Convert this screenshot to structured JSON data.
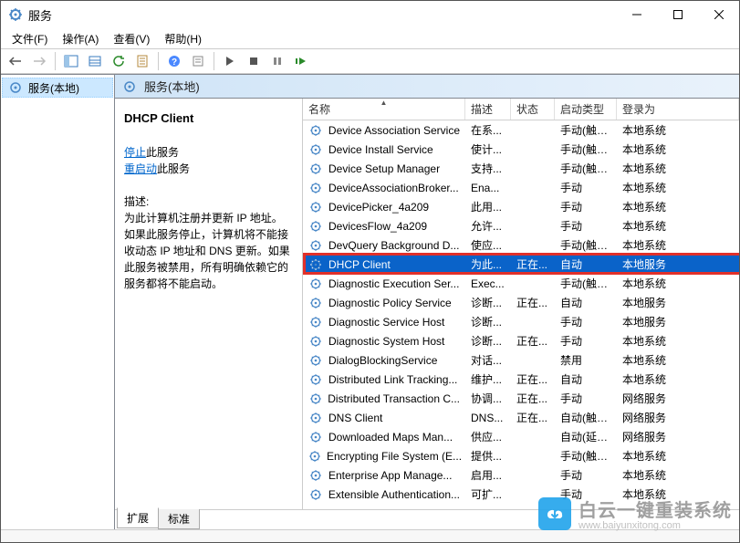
{
  "window": {
    "title": "服务"
  },
  "menubar": {
    "file": "文件(F)",
    "action": "操作(A)",
    "view": "查看(V)",
    "help": "帮助(H)"
  },
  "tree": {
    "root": "服务(本地)"
  },
  "rightHeader": {
    "label": "服务(本地)"
  },
  "detail": {
    "service_name": "DHCP Client",
    "stop_link": "停止",
    "stop_suffix": "此服务",
    "restart_link": "重启动",
    "restart_suffix": "此服务",
    "desc_label": "描述:",
    "desc_text": "为此计算机注册并更新 IP 地址。如果此服务停止，计算机将不能接收动态 IP 地址和 DNS 更新。如果此服务被禁用，所有明确依赖它的服务都将不能启动。"
  },
  "columns": {
    "name": "名称",
    "desc": "描述",
    "status": "状态",
    "start": "启动类型",
    "logon": "登录为"
  },
  "tabs": {
    "extended": "扩展",
    "standard": "标准"
  },
  "watermark": {
    "big": "白云一键重装系统",
    "small": "www.baiyunxitong.com"
  },
  "selected_index": 7,
  "services": [
    {
      "name": "Device Association Service",
      "desc": "在系...",
      "status": "",
      "start": "手动(触发...",
      "logon": "本地系统"
    },
    {
      "name": "Device Install Service",
      "desc": "使计...",
      "status": "",
      "start": "手动(触发...",
      "logon": "本地系统"
    },
    {
      "name": "Device Setup Manager",
      "desc": "支持...",
      "status": "",
      "start": "手动(触发...",
      "logon": "本地系统"
    },
    {
      "name": "DeviceAssociationBroker...",
      "desc": "Ena...",
      "status": "",
      "start": "手动",
      "logon": "本地系统"
    },
    {
      "name": "DevicePicker_4a209",
      "desc": "此用...",
      "status": "",
      "start": "手动",
      "logon": "本地系统"
    },
    {
      "name": "DevicesFlow_4a209",
      "desc": "允许...",
      "status": "",
      "start": "手动",
      "logon": "本地系统"
    },
    {
      "name": "DevQuery Background D...",
      "desc": "使应...",
      "status": "",
      "start": "手动(触发...",
      "logon": "本地系统"
    },
    {
      "name": "DHCP Client",
      "desc": "为此...",
      "status": "正在...",
      "start": "自动",
      "logon": "本地服务"
    },
    {
      "name": "Diagnostic Execution Ser...",
      "desc": "Exec...",
      "status": "",
      "start": "手动(触发...",
      "logon": "本地系统"
    },
    {
      "name": "Diagnostic Policy Service",
      "desc": "诊断...",
      "status": "正在...",
      "start": "自动",
      "logon": "本地服务"
    },
    {
      "name": "Diagnostic Service Host",
      "desc": "诊断...",
      "status": "",
      "start": "手动",
      "logon": "本地服务"
    },
    {
      "name": "Diagnostic System Host",
      "desc": "诊断...",
      "status": "正在...",
      "start": "手动",
      "logon": "本地系统"
    },
    {
      "name": "DialogBlockingService",
      "desc": "对话...",
      "status": "",
      "start": "禁用",
      "logon": "本地系统"
    },
    {
      "name": "Distributed Link Tracking...",
      "desc": "维护...",
      "status": "正在...",
      "start": "自动",
      "logon": "本地系统"
    },
    {
      "name": "Distributed Transaction C...",
      "desc": "协调...",
      "status": "正在...",
      "start": "手动",
      "logon": "网络服务"
    },
    {
      "name": "DNS Client",
      "desc": "DNS...",
      "status": "正在...",
      "start": "自动(触发...",
      "logon": "网络服务"
    },
    {
      "name": "Downloaded Maps Man...",
      "desc": "供应...",
      "status": "",
      "start": "自动(延迟...",
      "logon": "网络服务"
    },
    {
      "name": "Encrypting File System (E...",
      "desc": "提供...",
      "status": "",
      "start": "手动(触发...",
      "logon": "本地系统"
    },
    {
      "name": "Enterprise App Manage...",
      "desc": "启用...",
      "status": "",
      "start": "手动",
      "logon": "本地系统"
    },
    {
      "name": "Extensible Authentication...",
      "desc": "可扩...",
      "status": "",
      "start": "手动",
      "logon": "本地系统"
    }
  ]
}
